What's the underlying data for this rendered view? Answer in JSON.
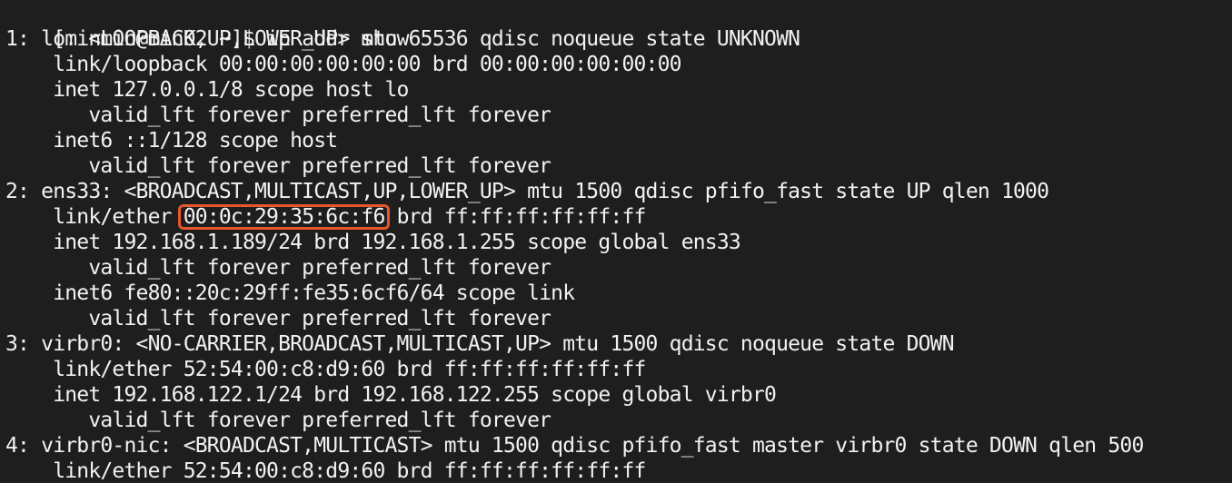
{
  "terminal": {
    "prompt_bracket": "[",
    "prompt": "[minmin@min02 ~]$ ip addr show",
    "lines": [
      "1: lo: <LOOPBACK,UP,LOWER_UP> mtu 65536 qdisc noqueue state UNKNOWN",
      "    link/loopback 00:00:00:00:00:00 brd 00:00:00:00:00:00",
      "    inet 127.0.0.1/8 scope host lo",
      "       valid_lft forever preferred_lft forever",
      "    inet6 ::1/128 scope host",
      "       valid_lft forever preferred_lft forever",
      "2: ens33: <BROADCAST,MULTICAST,UP,LOWER_UP> mtu 1500 qdisc pfifo_fast state UP qlen 1000"
    ],
    "highlight_line": {
      "before": "    link/ether ",
      "mac": "00:0c:29:35:6c:f6",
      "after": " brd ff:ff:ff:ff:ff:ff"
    },
    "lines_after": [
      "    inet 192.168.1.189/24 brd 192.168.1.255 scope global ens33",
      "       valid_lft forever preferred_lft forever",
      "    inet6 fe80::20c:29ff:fe35:6cf6/64 scope link",
      "       valid_lft forever preferred_lft forever",
      "3: virbr0: <NO-CARRIER,BROADCAST,MULTICAST,UP> mtu 1500 qdisc noqueue state DOWN",
      "    link/ether 52:54:00:c8:d9:60 brd ff:ff:ff:ff:ff:ff",
      "    inet 192.168.122.1/24 brd 192.168.122.255 scope global virbr0",
      "       valid_lft forever preferred_lft forever",
      "4: virbr0-nic: <BROADCAST,MULTICAST> mtu 1500 qdisc pfifo_fast master virbr0 state DOWN qlen 500",
      "    link/ether 52:54:00:c8:d9:60 brd ff:ff:ff:ff:ff:ff"
    ],
    "colors": {
      "background": "#1e1e1e",
      "text": "#f2f2f2",
      "highlight_box": "#e8562c"
    }
  }
}
